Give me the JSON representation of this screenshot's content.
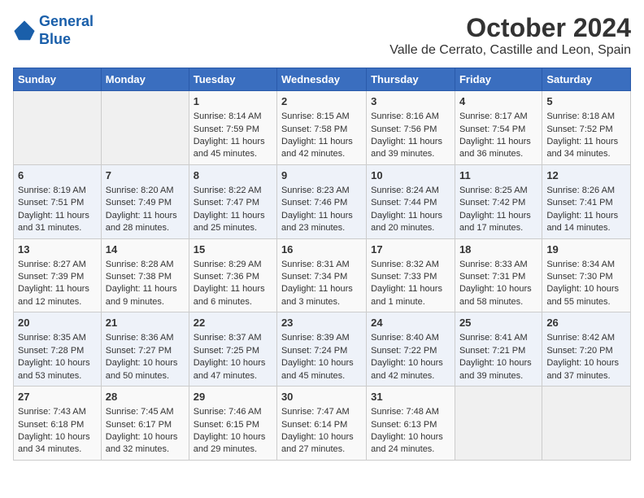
{
  "logo": {
    "line1": "General",
    "line2": "Blue"
  },
  "title": "October 2024",
  "location": "Valle de Cerrato, Castille and Leon, Spain",
  "weekdays": [
    "Sunday",
    "Monday",
    "Tuesday",
    "Wednesday",
    "Thursday",
    "Friday",
    "Saturday"
  ],
  "weeks": [
    [
      {
        "day": "",
        "sunrise": "",
        "sunset": "",
        "daylight": ""
      },
      {
        "day": "",
        "sunrise": "",
        "sunset": "",
        "daylight": ""
      },
      {
        "day": "1",
        "sunrise": "Sunrise: 8:14 AM",
        "sunset": "Sunset: 7:59 PM",
        "daylight": "Daylight: 11 hours and 45 minutes."
      },
      {
        "day": "2",
        "sunrise": "Sunrise: 8:15 AM",
        "sunset": "Sunset: 7:58 PM",
        "daylight": "Daylight: 11 hours and 42 minutes."
      },
      {
        "day": "3",
        "sunrise": "Sunrise: 8:16 AM",
        "sunset": "Sunset: 7:56 PM",
        "daylight": "Daylight: 11 hours and 39 minutes."
      },
      {
        "day": "4",
        "sunrise": "Sunrise: 8:17 AM",
        "sunset": "Sunset: 7:54 PM",
        "daylight": "Daylight: 11 hours and 36 minutes."
      },
      {
        "day": "5",
        "sunrise": "Sunrise: 8:18 AM",
        "sunset": "Sunset: 7:52 PM",
        "daylight": "Daylight: 11 hours and 34 minutes."
      }
    ],
    [
      {
        "day": "6",
        "sunrise": "Sunrise: 8:19 AM",
        "sunset": "Sunset: 7:51 PM",
        "daylight": "Daylight: 11 hours and 31 minutes."
      },
      {
        "day": "7",
        "sunrise": "Sunrise: 8:20 AM",
        "sunset": "Sunset: 7:49 PM",
        "daylight": "Daylight: 11 hours and 28 minutes."
      },
      {
        "day": "8",
        "sunrise": "Sunrise: 8:22 AM",
        "sunset": "Sunset: 7:47 PM",
        "daylight": "Daylight: 11 hours and 25 minutes."
      },
      {
        "day": "9",
        "sunrise": "Sunrise: 8:23 AM",
        "sunset": "Sunset: 7:46 PM",
        "daylight": "Daylight: 11 hours and 23 minutes."
      },
      {
        "day": "10",
        "sunrise": "Sunrise: 8:24 AM",
        "sunset": "Sunset: 7:44 PM",
        "daylight": "Daylight: 11 hours and 20 minutes."
      },
      {
        "day": "11",
        "sunrise": "Sunrise: 8:25 AM",
        "sunset": "Sunset: 7:42 PM",
        "daylight": "Daylight: 11 hours and 17 minutes."
      },
      {
        "day": "12",
        "sunrise": "Sunrise: 8:26 AM",
        "sunset": "Sunset: 7:41 PM",
        "daylight": "Daylight: 11 hours and 14 minutes."
      }
    ],
    [
      {
        "day": "13",
        "sunrise": "Sunrise: 8:27 AM",
        "sunset": "Sunset: 7:39 PM",
        "daylight": "Daylight: 11 hours and 12 minutes."
      },
      {
        "day": "14",
        "sunrise": "Sunrise: 8:28 AM",
        "sunset": "Sunset: 7:38 PM",
        "daylight": "Daylight: 11 hours and 9 minutes."
      },
      {
        "day": "15",
        "sunrise": "Sunrise: 8:29 AM",
        "sunset": "Sunset: 7:36 PM",
        "daylight": "Daylight: 11 hours and 6 minutes."
      },
      {
        "day": "16",
        "sunrise": "Sunrise: 8:31 AM",
        "sunset": "Sunset: 7:34 PM",
        "daylight": "Daylight: 11 hours and 3 minutes."
      },
      {
        "day": "17",
        "sunrise": "Sunrise: 8:32 AM",
        "sunset": "Sunset: 7:33 PM",
        "daylight": "Daylight: 11 hours and 1 minute."
      },
      {
        "day": "18",
        "sunrise": "Sunrise: 8:33 AM",
        "sunset": "Sunset: 7:31 PM",
        "daylight": "Daylight: 10 hours and 58 minutes."
      },
      {
        "day": "19",
        "sunrise": "Sunrise: 8:34 AM",
        "sunset": "Sunset: 7:30 PM",
        "daylight": "Daylight: 10 hours and 55 minutes."
      }
    ],
    [
      {
        "day": "20",
        "sunrise": "Sunrise: 8:35 AM",
        "sunset": "Sunset: 7:28 PM",
        "daylight": "Daylight: 10 hours and 53 minutes."
      },
      {
        "day": "21",
        "sunrise": "Sunrise: 8:36 AM",
        "sunset": "Sunset: 7:27 PM",
        "daylight": "Daylight: 10 hours and 50 minutes."
      },
      {
        "day": "22",
        "sunrise": "Sunrise: 8:37 AM",
        "sunset": "Sunset: 7:25 PM",
        "daylight": "Daylight: 10 hours and 47 minutes."
      },
      {
        "day": "23",
        "sunrise": "Sunrise: 8:39 AM",
        "sunset": "Sunset: 7:24 PM",
        "daylight": "Daylight: 10 hours and 45 minutes."
      },
      {
        "day": "24",
        "sunrise": "Sunrise: 8:40 AM",
        "sunset": "Sunset: 7:22 PM",
        "daylight": "Daylight: 10 hours and 42 minutes."
      },
      {
        "day": "25",
        "sunrise": "Sunrise: 8:41 AM",
        "sunset": "Sunset: 7:21 PM",
        "daylight": "Daylight: 10 hours and 39 minutes."
      },
      {
        "day": "26",
        "sunrise": "Sunrise: 8:42 AM",
        "sunset": "Sunset: 7:20 PM",
        "daylight": "Daylight: 10 hours and 37 minutes."
      }
    ],
    [
      {
        "day": "27",
        "sunrise": "Sunrise: 7:43 AM",
        "sunset": "Sunset: 6:18 PM",
        "daylight": "Daylight: 10 hours and 34 minutes."
      },
      {
        "day": "28",
        "sunrise": "Sunrise: 7:45 AM",
        "sunset": "Sunset: 6:17 PM",
        "daylight": "Daylight: 10 hours and 32 minutes."
      },
      {
        "day": "29",
        "sunrise": "Sunrise: 7:46 AM",
        "sunset": "Sunset: 6:15 PM",
        "daylight": "Daylight: 10 hours and 29 minutes."
      },
      {
        "day": "30",
        "sunrise": "Sunrise: 7:47 AM",
        "sunset": "Sunset: 6:14 PM",
        "daylight": "Daylight: 10 hours and 27 minutes."
      },
      {
        "day": "31",
        "sunrise": "Sunrise: 7:48 AM",
        "sunset": "Sunset: 6:13 PM",
        "daylight": "Daylight: 10 hours and 24 minutes."
      },
      {
        "day": "",
        "sunrise": "",
        "sunset": "",
        "daylight": ""
      },
      {
        "day": "",
        "sunrise": "",
        "sunset": "",
        "daylight": ""
      }
    ]
  ]
}
